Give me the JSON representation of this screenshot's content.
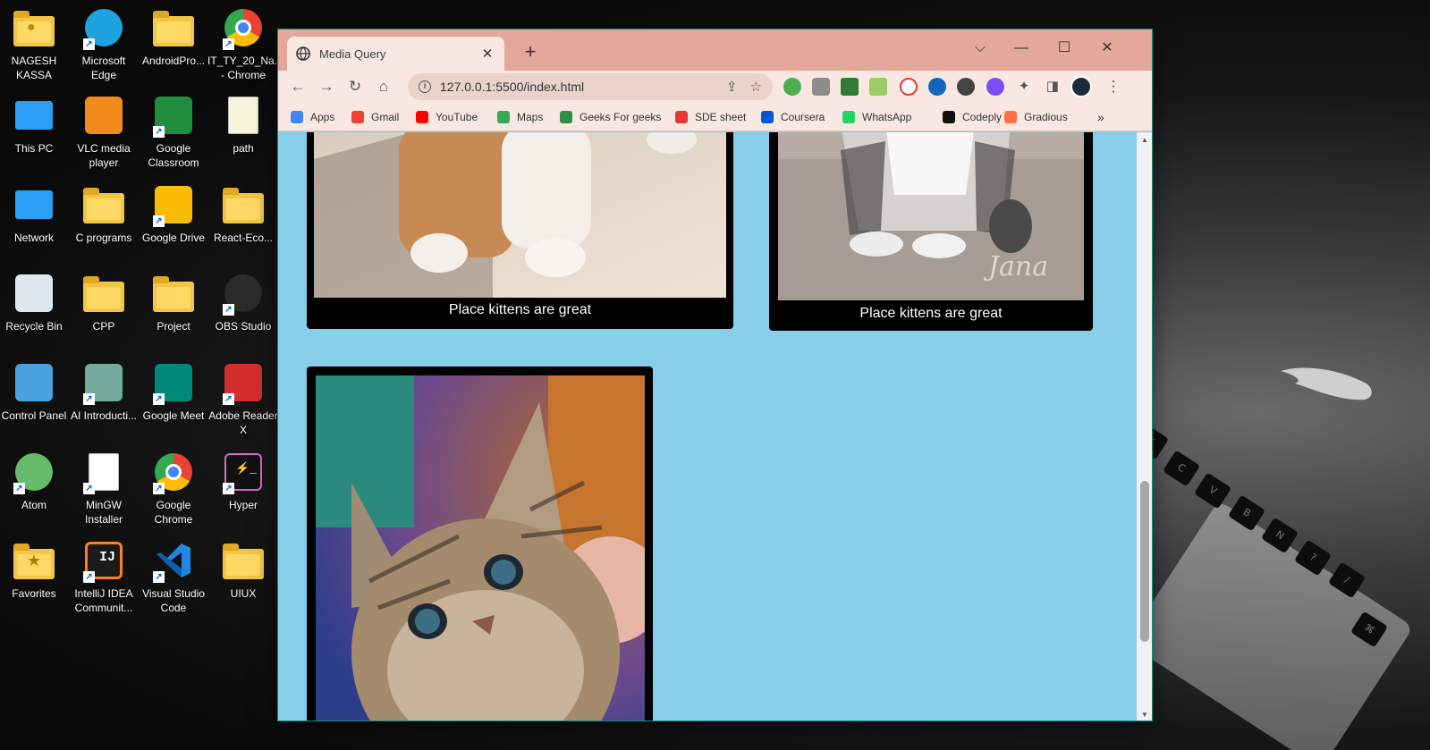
{
  "desktop": {
    "icons": [
      {
        "label": "NAGESH KASSA",
        "icon": "user-folder-icon"
      },
      {
        "label": "Microsoft Edge",
        "icon": "edge-icon"
      },
      {
        "label": "AndroidPro...",
        "icon": "folder-icon"
      },
      {
        "label": "IT_TY_20_Na... - Chrome",
        "icon": "chrome-profile-icon"
      },
      {
        "label": "This PC",
        "icon": "monitor-icon"
      },
      {
        "label": "VLC media player",
        "icon": "vlc-icon"
      },
      {
        "label": "Google Classroom",
        "icon": "classroom-icon"
      },
      {
        "label": "path",
        "icon": "script-icon"
      },
      {
        "label": "Network",
        "icon": "network-icon"
      },
      {
        "label": "C programs",
        "icon": "folder-icon"
      },
      {
        "label": "Google Drive",
        "icon": "google-drive-icon"
      },
      {
        "label": "React-Eco...",
        "icon": "folder-icon"
      },
      {
        "label": "Recycle Bin",
        "icon": "recycle-bin-icon"
      },
      {
        "label": "CPP",
        "icon": "folder-icon"
      },
      {
        "label": "Project",
        "icon": "folder-icon"
      },
      {
        "label": "OBS Studio",
        "icon": "obs-icon"
      },
      {
        "label": "Control Panel",
        "icon": "control-panel-icon"
      },
      {
        "label": "AI Introducti...",
        "icon": "chatgpt-icon"
      },
      {
        "label": "Google Meet",
        "icon": "google-meet-icon"
      },
      {
        "label": "Adobe Reader X",
        "icon": "adobe-reader-icon"
      },
      {
        "label": "Atom",
        "icon": "atom-icon"
      },
      {
        "label": "MinGW Installer",
        "icon": "file-icon"
      },
      {
        "label": "Google Chrome",
        "icon": "chrome-icon"
      },
      {
        "label": "Hyper",
        "icon": "hyper-terminal-icon"
      },
      {
        "label": "Favorites",
        "icon": "favorites-folder-icon"
      },
      {
        "label": "IntelliJ IDEA Communit...",
        "icon": "intellij-icon"
      },
      {
        "label": "Visual Studio Code",
        "icon": "vscode-icon"
      },
      {
        "label": "UIUX",
        "icon": "folder-icon"
      }
    ]
  },
  "browser": {
    "tab_title": "Media Query",
    "tab_close": "✕",
    "new_tab": "+",
    "url": "127.0.0.1:5500/index.html",
    "bookmarks": [
      {
        "label": "Apps",
        "color": "#4285f4"
      },
      {
        "label": "Gmail",
        "color": "#ea4335"
      },
      {
        "label": "YouTube",
        "color": "#ff0000"
      },
      {
        "label": "Maps",
        "color": "#34a853"
      },
      {
        "label": "Geeks For geeks",
        "color": "#2f8d46"
      },
      {
        "label": "SDE sheet",
        "color": "#e53935"
      },
      {
        "label": "Coursera",
        "color": "#0056d2"
      },
      {
        "label": "WhatsApp",
        "color": "#25d366"
      },
      {
        "label": "Codeply",
        "color": "#111111"
      },
      {
        "label": "Gradious",
        "color": "#ff7043"
      }
    ],
    "bookmarks_more": "»"
  },
  "page": {
    "background": "#87ceeb",
    "cards": [
      {
        "caption": "Place kittens are great"
      },
      {
        "caption": "Place kittens are great"
      },
      {
        "caption": ""
      }
    ]
  }
}
